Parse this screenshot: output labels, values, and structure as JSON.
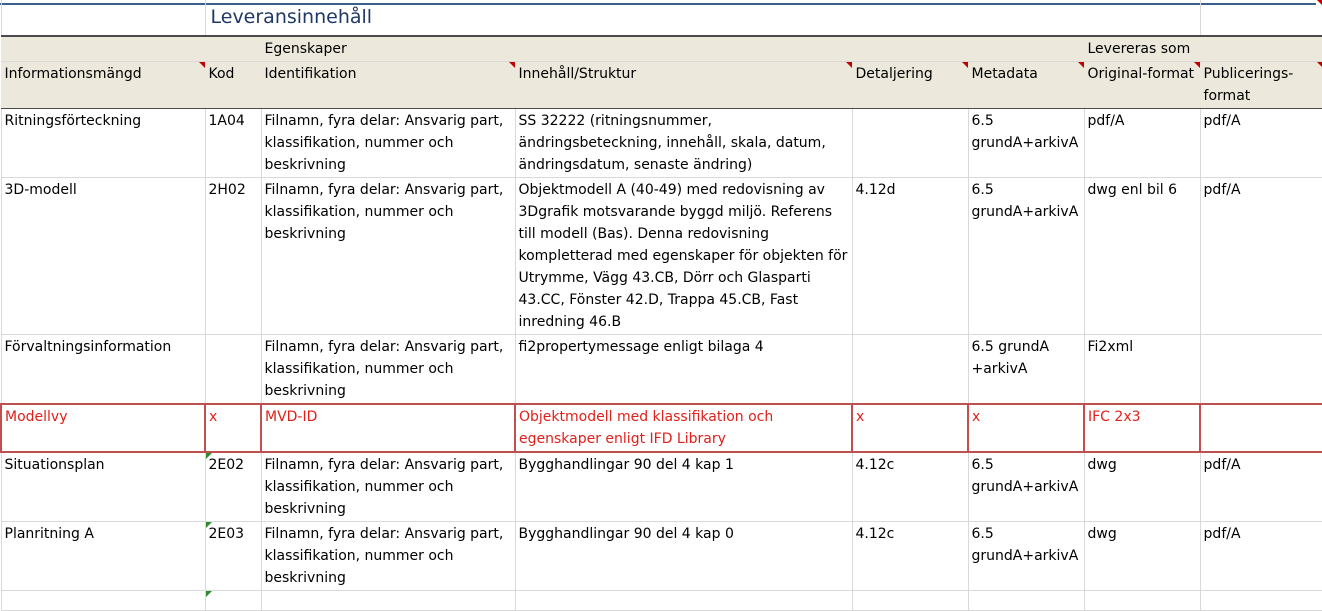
{
  "title": "Leveransinnehåll",
  "groups": {
    "properties": "Egenskaper",
    "delivered_as": "Levereras som"
  },
  "columns": [
    "Informationsmängd",
    "Kod",
    "Identifikation",
    "Innehåll/Struktur",
    "Detaljering",
    "Metadata",
    "Original-format",
    "Publicerings-format"
  ],
  "rows": [
    {
      "info": "Ritningsförteckning",
      "code": "1A04",
      "ident": "Filnamn, fyra delar: Ansvarig part, klassifikation, nummer och beskrivning",
      "content": "SS 32222 (ritningsnummer, ändringsbeteckning, innehåll, skala, datum, ändringsdatum, senaste ändring)",
      "detail": "",
      "meta": "6.5 grundA+arkivA",
      "orig": "pdf/A",
      "pub": "pdf/A"
    },
    {
      "info": "3D-modell",
      "code": "2H02",
      "ident": "Filnamn, fyra delar: Ansvarig part, klassifikation, nummer och beskrivning",
      "content": "Objektmodell A (40-49) med redovisning av 3Dgrafik motsvarande byggd miljö. Referens till modell (Bas). Denna redovisning kompletterad med egenskaper för objekten för Utrymme, Vägg 43.CB, Dörr  och Glasparti 43.CC, Fönster 42.D, Trappa 45.CB, Fast inredning 46.B",
      "detail": "4.12d",
      "meta": "6.5 grundA+arkivA",
      "orig": "dwg enl bil 6",
      "pub": "pdf/A"
    },
    {
      "info": "Förvaltningsinformation",
      "code": "",
      "ident": "Filnamn, fyra delar: Ansvarig part, klassifikation, nummer och beskrivning",
      "content": "fi2propertymessage enligt bilaga 4",
      "detail": "",
      "meta": "6.5 grundA +arkivA",
      "orig": "Fi2xml",
      "pub": ""
    },
    {
      "info": "Modellvy",
      "code": "x",
      "ident": "MVD-ID",
      "content": "Objektmodell med klassifikation och egenskaper enligt IFD Library",
      "detail": "x",
      "meta": "x",
      "orig": "IFC 2x3",
      "pub": ""
    },
    {
      "info": "Situationsplan",
      "code": "2E02",
      "ident": "Filnamn, fyra delar: Ansvarig part, klassifikation, nummer och beskrivning",
      "content": "Bygghandlingar 90 del 4 kap 1",
      "detail": "4.12c",
      "meta": "6.5 grundA+arkivA",
      "orig": "dwg",
      "pub": "pdf/A"
    },
    {
      "info": "Planritning A",
      "code": "2E03",
      "ident": "Filnamn, fyra delar: Ansvarig part, klassifikation, nummer och beskrivning",
      "content": "Bygghandlingar 90 del 4 kap 0",
      "detail": "4.12c",
      "meta": "6.5 grundA+arkivA",
      "orig": "dwg",
      "pub": "pdf/A"
    }
  ]
}
